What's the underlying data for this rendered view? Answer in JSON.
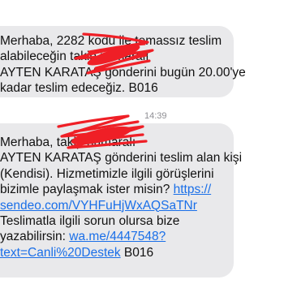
{
  "thread": {
    "timestamp": "14:39",
    "messages": [
      {
        "lines": [
          "Merhaba, 2282 kodu ile temassız teslim",
          "alabileceğin                takip numaralı",
          "AYTEN KARATAŞ gönderini bugün 20.00'ye",
          "kadar teslim edeceğiz. B016"
        ]
      },
      {
        "lines": [
          "Merhaba,                             takip numaralı",
          "AYTEN KARATAŞ gönderini teslim alan kişi",
          "(Kendisi). Hizmetimizle ilgili görüşlerini",
          "bizimle paylaşmak ister misin? "
        ],
        "link_1_line_a": "https://",
        "link_1_line_b": "sendeo.com/VYHFuHjWxAQSaTNr",
        "line_5": "Teslimatla ilgili sorun olursa bize",
        "line_6_text": "yazabilirsin: ",
        "link_2_line_a": "wa.me/4447548?",
        "link_2_line_b": "text=Canli%20Destek",
        "line_7_tail": " B016"
      }
    ]
  },
  "colors": {
    "bubble": "#e9e9eb",
    "text": "#111111",
    "link": "#1a6fe8",
    "redaction": "#ef1f26"
  }
}
